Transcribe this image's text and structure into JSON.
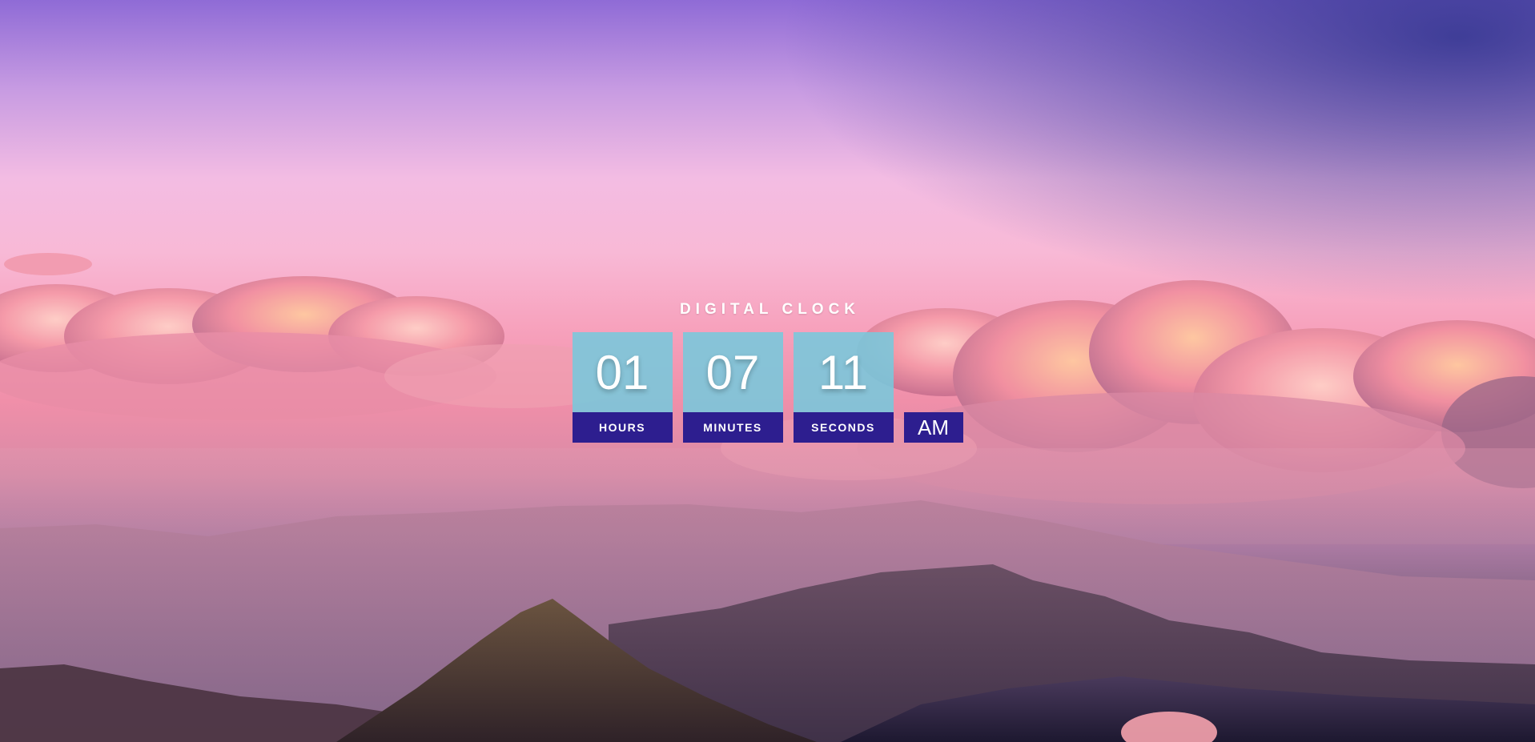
{
  "clock": {
    "title": "DIGITAL CLOCK",
    "hours": {
      "value": "01",
      "label": "HOURS"
    },
    "minutes": {
      "value": "07",
      "label": "MINUTES"
    },
    "seconds": {
      "value": "11",
      "label": "SECONDS"
    },
    "period": "AM"
  },
  "background": {
    "scene": "pink-sunset-clouds-over-mountains",
    "colors": {
      "sky_top": "#8f6bd6",
      "sky_pink": "#f8b9d6",
      "sky_shade": "#2d3290",
      "digit_tile": "#78c8dc",
      "label_bar": "#2d1e8f"
    }
  }
}
